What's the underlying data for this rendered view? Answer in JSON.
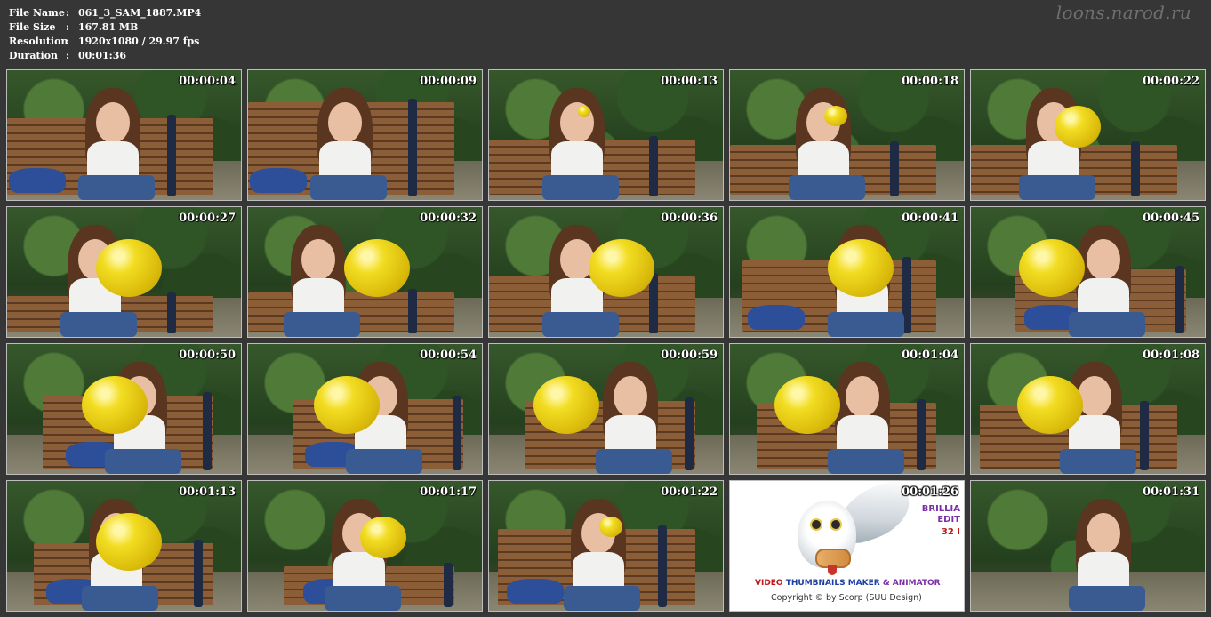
{
  "header": {
    "file_name_label": "File Name",
    "file_name_value": "061_3_SAM_1887.MP4",
    "file_size_label": "File Size",
    "file_size_value": "167.81 MB",
    "resolution_label": "Resolution",
    "resolution_value": "1920x1080 / 29.97 fps",
    "duration_label": "Duration",
    "duration_value": "00:01:36",
    "separator": ":"
  },
  "watermark": "loons.narod.ru",
  "thumbnails": [
    {
      "timestamp": "00:00:04",
      "balloon": "none"
    },
    {
      "timestamp": "00:00:09",
      "balloon": "none"
    },
    {
      "timestamp": "00:00:13",
      "balloon": "tiny"
    },
    {
      "timestamp": "00:00:18",
      "balloon": "small"
    },
    {
      "timestamp": "00:00:22",
      "balloon": "medium"
    },
    {
      "timestamp": "00:00:27",
      "balloon": "large"
    },
    {
      "timestamp": "00:00:32",
      "balloon": "large"
    },
    {
      "timestamp": "00:00:36",
      "balloon": "large"
    },
    {
      "timestamp": "00:00:41",
      "balloon": "large"
    },
    {
      "timestamp": "00:00:45",
      "balloon": "large"
    },
    {
      "timestamp": "00:00:50",
      "balloon": "large"
    },
    {
      "timestamp": "00:00:54",
      "balloon": "large"
    },
    {
      "timestamp": "00:00:59",
      "balloon": "large"
    },
    {
      "timestamp": "00:01:04",
      "balloon": "large"
    },
    {
      "timestamp": "00:01:08",
      "balloon": "large"
    },
    {
      "timestamp": "00:01:13",
      "balloon": "large"
    },
    {
      "timestamp": "00:01:17",
      "balloon": "medium"
    },
    {
      "timestamp": "00:01:22",
      "balloon": "small"
    },
    {
      "timestamp": "00:01:26",
      "balloon": "none"
    },
    {
      "timestamp": "00:01:31",
      "balloon": "none"
    }
  ],
  "promo": {
    "side_line1": "BRILLIA",
    "side_line2": "EDIT",
    "side_line3": "32 I",
    "title_part1": "VIDEO ",
    "title_part2": "THUMBNAILS MAKER",
    "title_part3": " & ANIMATOR",
    "copyright": "Copyright © by Scorp (SUU Design)"
  },
  "colors": {
    "background": "#363636",
    "balloon": "#f2dd22",
    "promo_red": "#c01818",
    "promo_blue": "#1a3fa0",
    "promo_purple": "#7a2fa6"
  }
}
